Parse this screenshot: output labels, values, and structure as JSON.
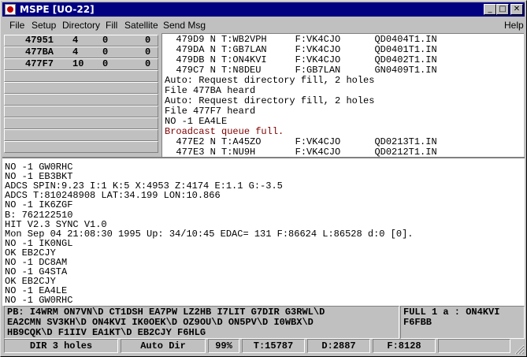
{
  "window": {
    "title": "MSPE [UO-22]"
  },
  "title_buttons": {
    "minimize": "_",
    "maximize": "□",
    "close": "✕"
  },
  "menu": {
    "file": "File",
    "setup": "Setup",
    "directory": "Directory",
    "fill": "Fill",
    "satellite": "Satellite",
    "send_msg": "Send Msg",
    "help": "Help"
  },
  "file_list": [
    {
      "id": "47951",
      "a": "4",
      "b": "0",
      "c": "0"
    },
    {
      "id": "477BA",
      "a": "4",
      "b": "0",
      "c": "0"
    },
    {
      "id": "477F7",
      "a": "10",
      "b": "0",
      "c": "0"
    }
  ],
  "directory_lines": [
    {
      "text": "  479D9 N T:WB2VPH     F:VK4CJO      QD0404T1.IN",
      "color": "#000000"
    },
    {
      "text": "  479DA N T:GB7LAN     F:VK4CJO      QD0401T1.IN",
      "color": "#000000"
    },
    {
      "text": "  479DB N T:ON4KVI     F:VK4CJO      QD0402T1.IN",
      "color": "#000000"
    },
    {
      "text": "  479C7 N T:N8DEU      F:GB7LAN      GN0409T1.IN",
      "color": "#000000"
    },
    {
      "text": "Auto: Request directory fill, 2 holes",
      "color": "#000000"
    },
    {
      "text": "File 477BA heard",
      "color": "#000000"
    },
    {
      "text": "Auto: Request directory fill, 2 holes",
      "color": "#000000"
    },
    {
      "text": "File 477F7 heard",
      "color": "#000000"
    },
    {
      "text": "NO -1 EA4LE",
      "color": "#000000"
    },
    {
      "text": "Broadcast queue full.",
      "color": "#800000"
    },
    {
      "text": "  477E2 N T:A45ZO      F:VK4CJO      QD0213T1.IN",
      "color": "#000000"
    },
    {
      "text": "  477E3 N T:NU9H       F:VK4CJO      QD0212T1.IN",
      "color": "#000000"
    }
  ],
  "log_lines": [
    "NO -1 GW0RHC",
    "NO -1 EB3BKT",
    "ADCS SPIN:9.23 I:1 K:5 X:4953 Z:4174 E:1.1 G:-3.5",
    "ADCS T:810248908 LAT:34.199 LON:10.866",
    "NO -1 IK6ZGF",
    "B: 762122510",
    "HIT V2.3 SYNC V1.0",
    "Mon Sep 04 21:08:30 1995 Up: 34/10:45 EDAC= 131 F:86624 L:86528 d:0 [0].",
    "NO -1 IK0NGL",
    "OK EB2CJY",
    "NO -1 DC8AM",
    "NO -1 G4STA",
    "OK EB2CJY",
    "NO -1 EA4LE",
    "NO -1 GW0RHC"
  ],
  "pb_lines": [
    "PB: I4WRM ON7VN\\D CT1DSH EA7PW LZ2HB I7LIT G7DIR G3RWL\\D",
    "EA2CMN SV3KH\\D ON4KVI IK0OEK\\D OZ9OU\\D ON5PV\\D I0WBX\\D",
    "HB9CQK\\D F1IIV EA1KT\\D EB2CJY F6HLG"
  ],
  "full_lines": [
    "FULL 1 a : ON4KVI",
    "F6FBB"
  ],
  "status": {
    "dir": "DIR 3 holes",
    "mode": "Auto Dir",
    "pct": "99%",
    "t": "T:15787",
    "d": "D:2887",
    "f": "F:8128"
  }
}
